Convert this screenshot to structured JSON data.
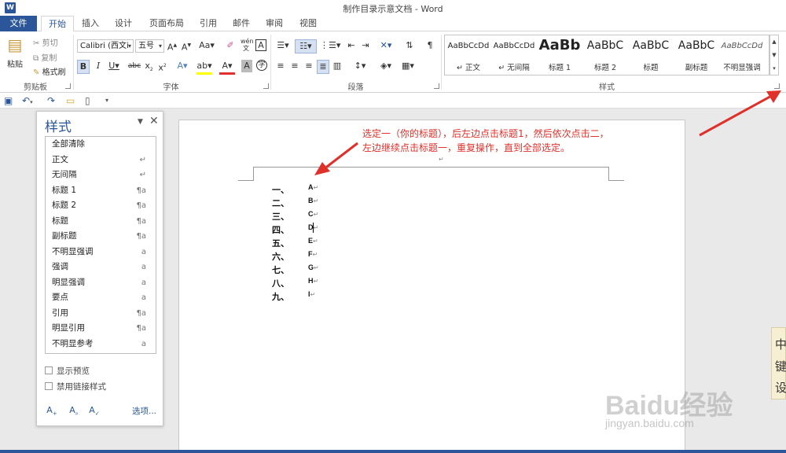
{
  "window": {
    "title": "制作目录示意文档 - Word",
    "app_icon": "W"
  },
  "tabs": [
    {
      "label": "文件"
    },
    {
      "label": "开始"
    },
    {
      "label": "插入"
    },
    {
      "label": "设计"
    },
    {
      "label": "页面布局"
    },
    {
      "label": "引用"
    },
    {
      "label": "邮件"
    },
    {
      "label": "审阅"
    },
    {
      "label": "视图"
    }
  ],
  "ribbon": {
    "clipboard": {
      "paste": "粘贴",
      "cut": "剪切",
      "copy": "复制",
      "format_painter": "格式刷",
      "group": "剪贴板"
    },
    "font": {
      "font_name": "Calibri (西文i",
      "font_size": "五号",
      "group": "字体"
    },
    "paragraph": {
      "group": "段落"
    },
    "styles": {
      "group": "样式",
      "items": [
        {
          "sample": "AaBbCcDd",
          "name": "↵ 正文"
        },
        {
          "sample": "AaBbCcDd",
          "name": "↵ 无间隔"
        },
        {
          "sample": "AaBb",
          "name": "标题 1"
        },
        {
          "sample": "AaBbC",
          "name": "标题 2"
        },
        {
          "sample": "AaBbC",
          "name": "标题"
        },
        {
          "sample": "AaBbC",
          "name": "副标题"
        },
        {
          "sample": "AaBbCcDd",
          "name": "不明显强调"
        }
      ]
    }
  },
  "styles_pane": {
    "title": "样式",
    "items": [
      {
        "name": "全部清除",
        "mark": ""
      },
      {
        "name": "正文",
        "mark": "↵"
      },
      {
        "name": "无间隔",
        "mark": "↵"
      },
      {
        "name": "标题 1",
        "mark": "¶a"
      },
      {
        "name": "标题 2",
        "mark": "¶a"
      },
      {
        "name": "标题",
        "mark": "¶a"
      },
      {
        "name": "副标题",
        "mark": "¶a"
      },
      {
        "name": "不明显强调",
        "mark": "a"
      },
      {
        "name": "强调",
        "mark": "a"
      },
      {
        "name": "明显强调",
        "mark": "a"
      },
      {
        "name": "要点",
        "mark": "a"
      },
      {
        "name": "引用",
        "mark": "¶a"
      },
      {
        "name": "明显引用",
        "mark": "¶a"
      },
      {
        "name": "不明显参考",
        "mark": "a"
      }
    ],
    "show_preview": "显示预览",
    "disable_linked": "禁用链接样式",
    "options": "选项..."
  },
  "document": {
    "header_mark": "↵",
    "rows": [
      {
        "num": "一、",
        "text": "A"
      },
      {
        "num": "二、",
        "text": "B"
      },
      {
        "num": "三、",
        "text": "C"
      },
      {
        "num": "四、",
        "text": "D"
      },
      {
        "num": "五、",
        "text": "E"
      },
      {
        "num": "六、",
        "text": "F"
      },
      {
        "num": "七、",
        "text": "G"
      },
      {
        "num": "八、",
        "text": "H"
      },
      {
        "num": "九、",
        "text": "I"
      }
    ],
    "para_mark": "↵"
  },
  "annotation": {
    "line1": "选定一（你的标题），后左边点击标题1，然后依次点击二，",
    "line2": "左边继续点击标题一，重复操作，直到全部选定。"
  },
  "side_panel": {
    "chars": [
      "中",
      "键",
      "设"
    ]
  },
  "watermark": {
    "main": "Baidu经验",
    "sub": "jingyan.baidu.com"
  },
  "colors": {
    "accent": "#2b579a",
    "annotation": "#e0302a"
  }
}
